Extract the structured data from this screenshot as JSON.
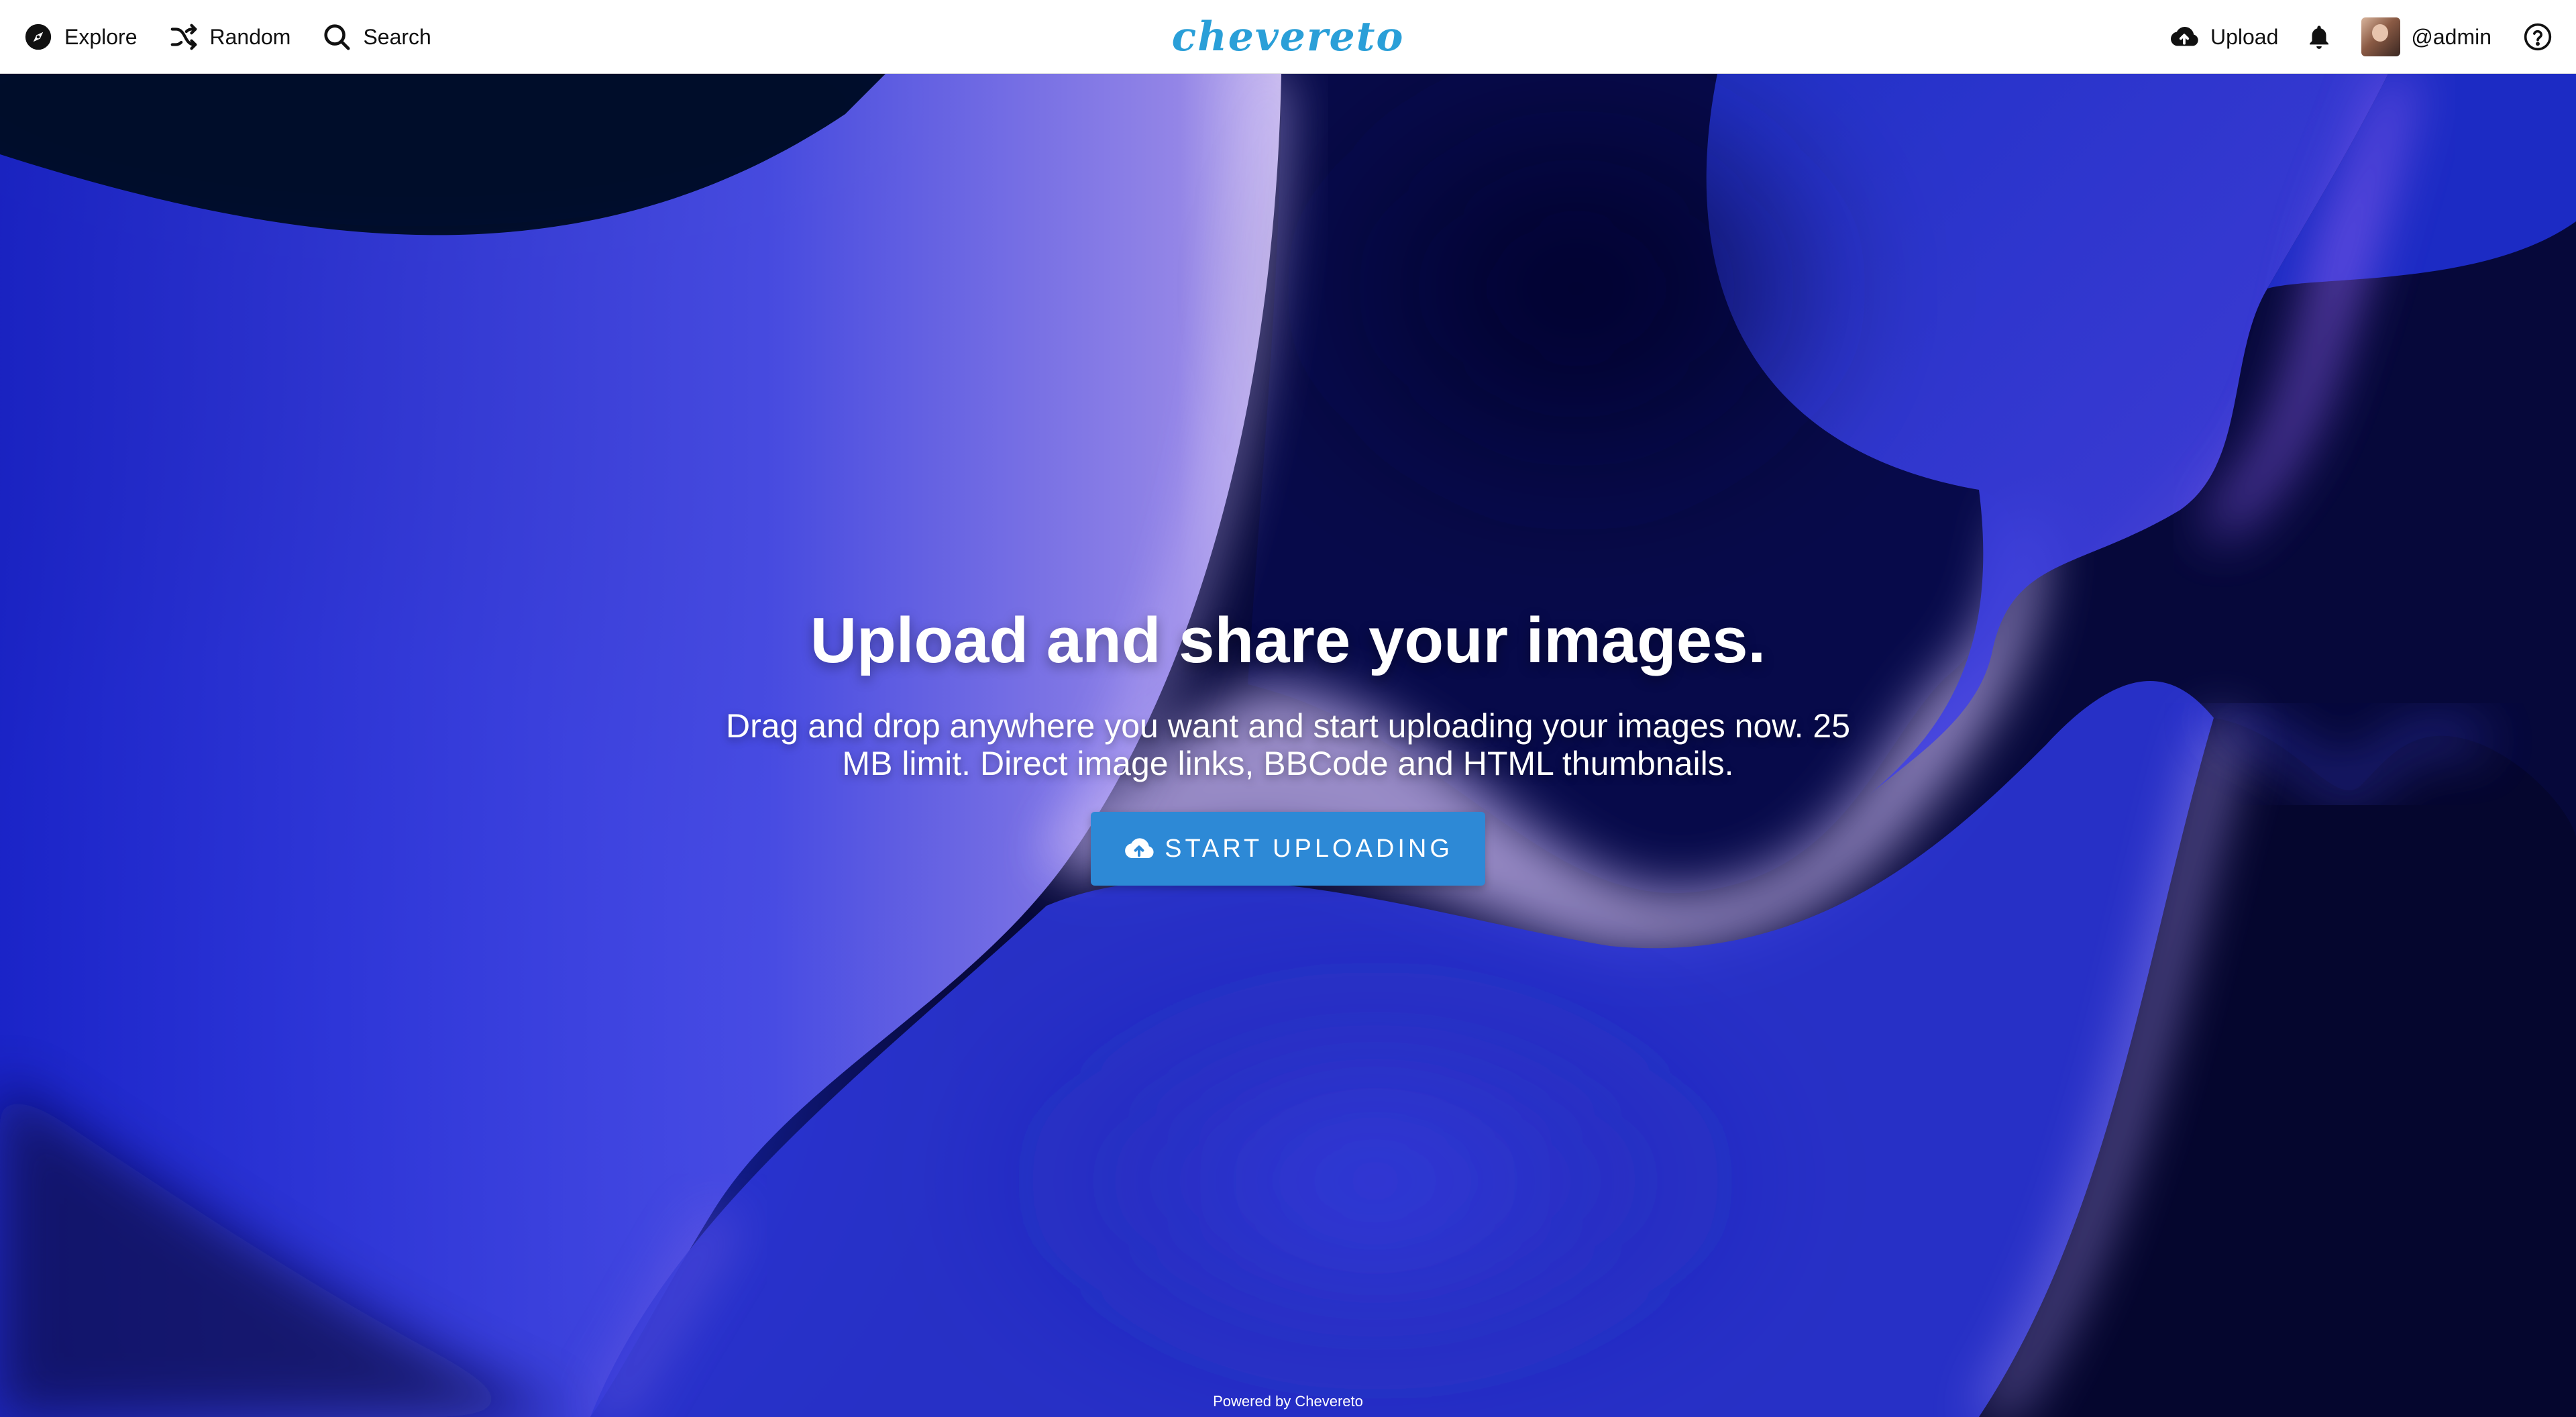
{
  "header": {
    "nav_left": [
      {
        "label": "Explore",
        "icon": "compass-icon"
      },
      {
        "label": "Random",
        "icon": "shuffle-icon"
      },
      {
        "label": "Search",
        "icon": "search-icon"
      }
    ],
    "logo_text": "chevereto",
    "upload_label": "Upload",
    "upload_icon": "cloud-upload-icon",
    "notifications_icon": "bell-icon",
    "username": "@admin",
    "help_icon": "help-circle-icon"
  },
  "hero": {
    "headline": "Upload and share your images.",
    "subline": "Drag and drop anywhere you want and start uploading your images now. 25 MB limit. Direct image links, BBCode and HTML thumbnails.",
    "cta_label": "START UPLOADING",
    "cta_icon": "cloud-upload-icon"
  },
  "footer": {
    "text": "Powered by Chevereto"
  },
  "colors": {
    "brand": "#2a9fd8",
    "cta": "#2d89d6",
    "hero_dark": "#05062e",
    "hero_blue": "#2230e0",
    "hero_light": "#b9a8f2"
  }
}
